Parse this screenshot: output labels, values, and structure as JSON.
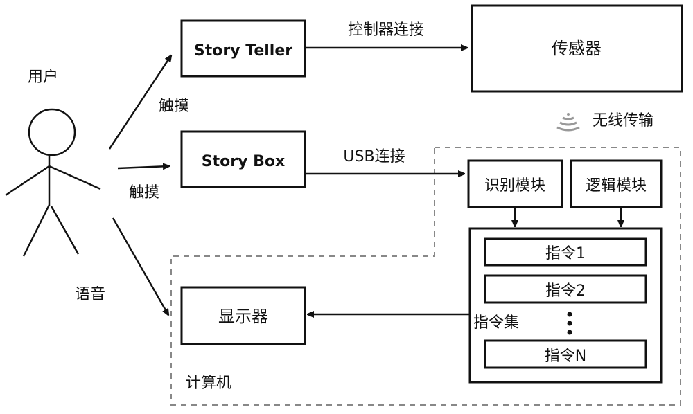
{
  "user": {
    "label": "用户"
  },
  "edges": {
    "touch_top": "触摸",
    "touch_mid": "触摸",
    "voice": "语音",
    "controller": "控制器连接",
    "usb": "USB连接",
    "wireless": "无线传输"
  },
  "nodes": {
    "story_teller": "Story Teller",
    "story_box": "Story Box",
    "sensor": "传感器",
    "display": "显示器",
    "recognition": "识别模块",
    "logic": "逻辑模块",
    "instruction_set": "指令集",
    "instructions": [
      "指令1",
      "指令2",
      "指令N"
    ],
    "ellipsis": "⋮"
  },
  "groups": {
    "computer": "计算机"
  },
  "colors": {
    "stroke": "#111111",
    "dashed": "#888888",
    "wireless_icon": "#999999"
  }
}
